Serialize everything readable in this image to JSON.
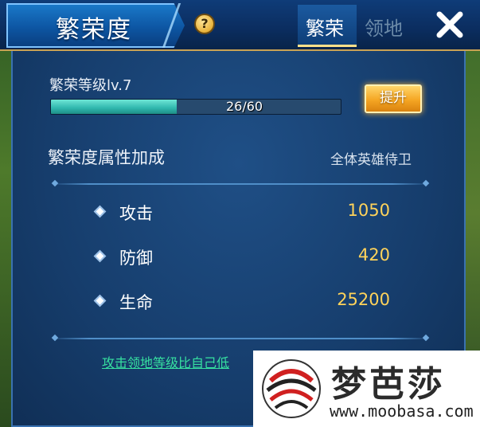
{
  "header": {
    "title": "繁荣度",
    "help_icon": "question-icon",
    "tabs": [
      {
        "label": "繁荣",
        "active": true
      },
      {
        "label": "领地",
        "active": false
      }
    ],
    "close_icon": "close-icon"
  },
  "prosperity": {
    "level_label": "繁荣等级lv.7",
    "progress_text": "26/60",
    "progress_current": 26,
    "progress_max": 60,
    "upgrade_label": "提升"
  },
  "attributes": {
    "section_title": "繁荣度属性加成",
    "target": "全体英雄侍卫",
    "items": [
      {
        "name": "攻击",
        "value": "1050"
      },
      {
        "name": "防御",
        "value": "420"
      },
      {
        "name": "生命",
        "value": "25200"
      }
    ]
  },
  "footer": {
    "link_text": "攻击领地等级比自己低"
  },
  "watermark": {
    "name": "梦芭莎",
    "url": "www.moobasa.com"
  },
  "colors": {
    "accent_gold": "#ffd35a",
    "progress": "#2fb7ad",
    "link_green": "#36e0a0",
    "panel_blue": "#163d6c"
  }
}
